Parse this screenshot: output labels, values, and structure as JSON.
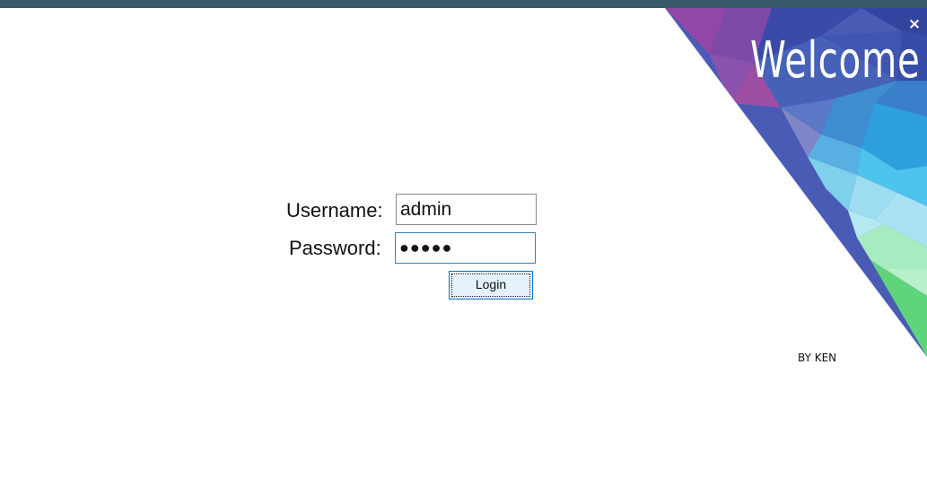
{
  "window": {
    "close_glyph": "×",
    "title_color": "#3a5a6b"
  },
  "banner": {
    "welcome_text": "Welcome",
    "palette": [
      "#8e44ad",
      "#3949ab",
      "#3f7fd0",
      "#4fc3f7",
      "#a5e9f0",
      "#9eecb4",
      "#5fd47a"
    ]
  },
  "form": {
    "username_label": "Username:",
    "username_value": "admin",
    "password_label": "Password:",
    "password_value": "●●●●●",
    "login_label": "Login"
  },
  "footer": {
    "credit": "BY KEN"
  }
}
